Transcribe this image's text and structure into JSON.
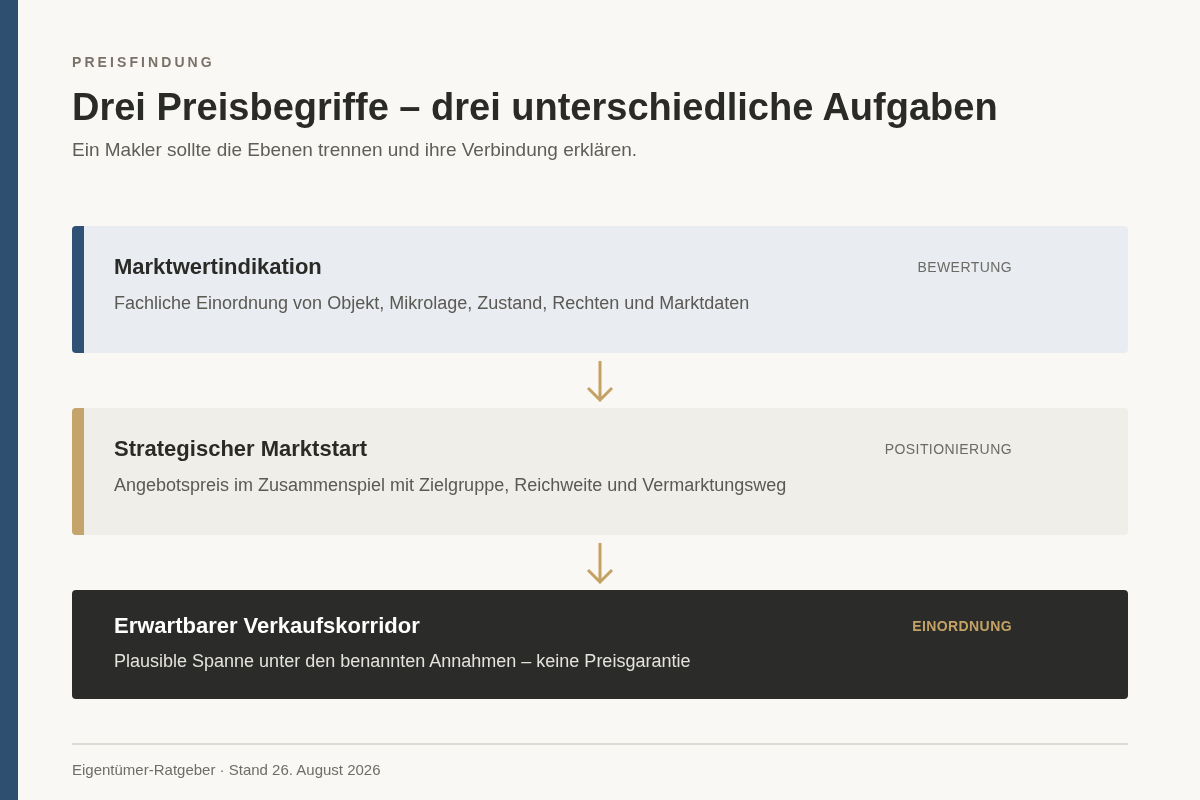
{
  "eyebrow": "PREISFINDUNG",
  "title": "Drei Preisbegriffe – drei unterschiedliche Aufgaben",
  "subtitle": "Ein Makler sollte die Ebenen trennen und ihre Verbindung erklären.",
  "levels": [
    {
      "kind": "cool",
      "color": "#2f5175",
      "title": "Marktwertindikation",
      "tag": "BEWERTUNG",
      "description": "Fachliche Einordnung von Objekt, Mikrolage, Zustand, Rechten und Marktdaten"
    },
    {
      "kind": "warm",
      "color": "#c4a46a",
      "title": "Strategischer Marktstart",
      "tag": "POSITIONIERUNG",
      "description": "Angebotspreis im Zusammenspiel mit Zielgruppe, Reichweite und Vermarktungsweg"
    },
    {
      "kind": "dark",
      "title": "Erwartbarer Verkaufskorridor",
      "tag": "EINORDNUNG",
      "description": "Plausible Spanne unter den benannten Annahmen – keine Preisgarantie"
    }
  ],
  "footer": "Eigentümer-Ratgeber · Stand 26. August 2026"
}
